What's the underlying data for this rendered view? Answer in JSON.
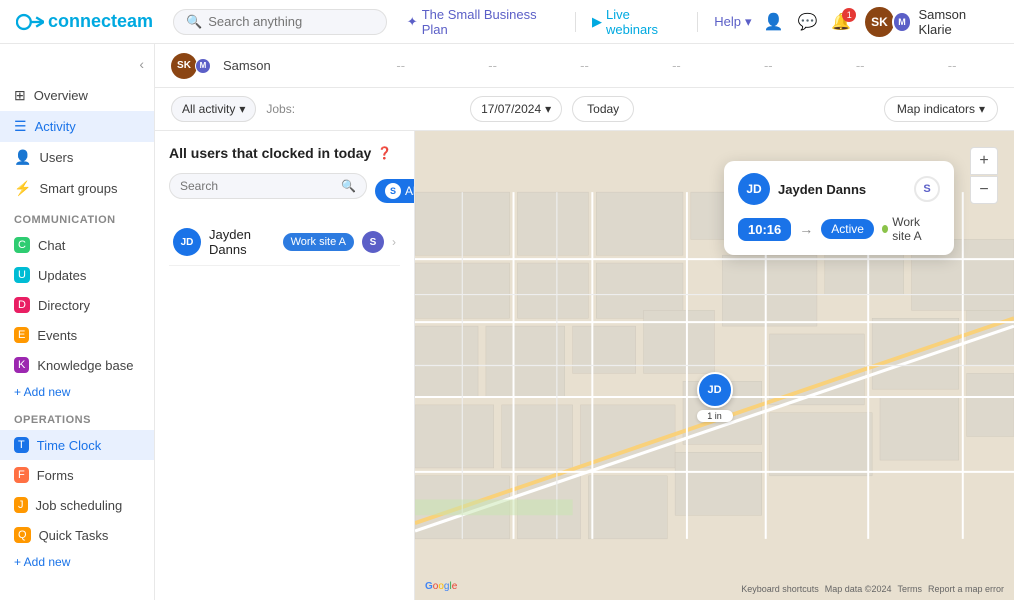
{
  "app": {
    "logo_text": "connecteam"
  },
  "topbar": {
    "search_placeholder": "Search anything",
    "plan_link": "The Small Business Plan",
    "webinar_link": "Live webinars",
    "help_label": "Help",
    "user_name": "Samson Klarie",
    "notification_count": "1"
  },
  "sidebar": {
    "overview_label": "Overview",
    "activity_label": "Activity",
    "users_label": "Users",
    "smart_groups_label": "Smart groups",
    "communication_label": "Communication",
    "chat_label": "Chat",
    "updates_label": "Updates",
    "directory_label": "Directory",
    "events_label": "Events",
    "knowledge_base_label": "Knowledge base",
    "add_new_label": "+ Add new",
    "operations_label": "Operations",
    "time_clock_label": "Time Clock",
    "forms_label": "Forms",
    "job_scheduling_label": "Job scheduling",
    "quick_tasks_label": "Quick Tasks",
    "add_new2_label": "+ Add new"
  },
  "table": {
    "user_name": "Samson",
    "dashes": [
      "--",
      "--",
      "--",
      "--",
      "--",
      "--",
      "--"
    ]
  },
  "toolbar": {
    "all_activity_label": "All activity",
    "jobs_label": "Jobs:",
    "date_label": "17/07/2024",
    "today_label": "Today",
    "map_indicators_label": "Map indicators"
  },
  "left_panel": {
    "title": "All users that clocked in today",
    "search_placeholder": "Search",
    "all_label": "All",
    "user_name": "Jayden Danns",
    "worksite": "Work site A"
  },
  "popup": {
    "user_name": "Jayden Danns",
    "time": "10:16",
    "status": "Active",
    "worksite": "Work site A"
  },
  "map_footer": {
    "google_label": "Google",
    "keyboard_label": "Keyboard shortcuts",
    "map_data_label": "Map data ©2024",
    "terms_label": "Terms",
    "report_label": "Report a map error"
  },
  "pin": {
    "initials": "JD",
    "sub_label": "1 in"
  }
}
